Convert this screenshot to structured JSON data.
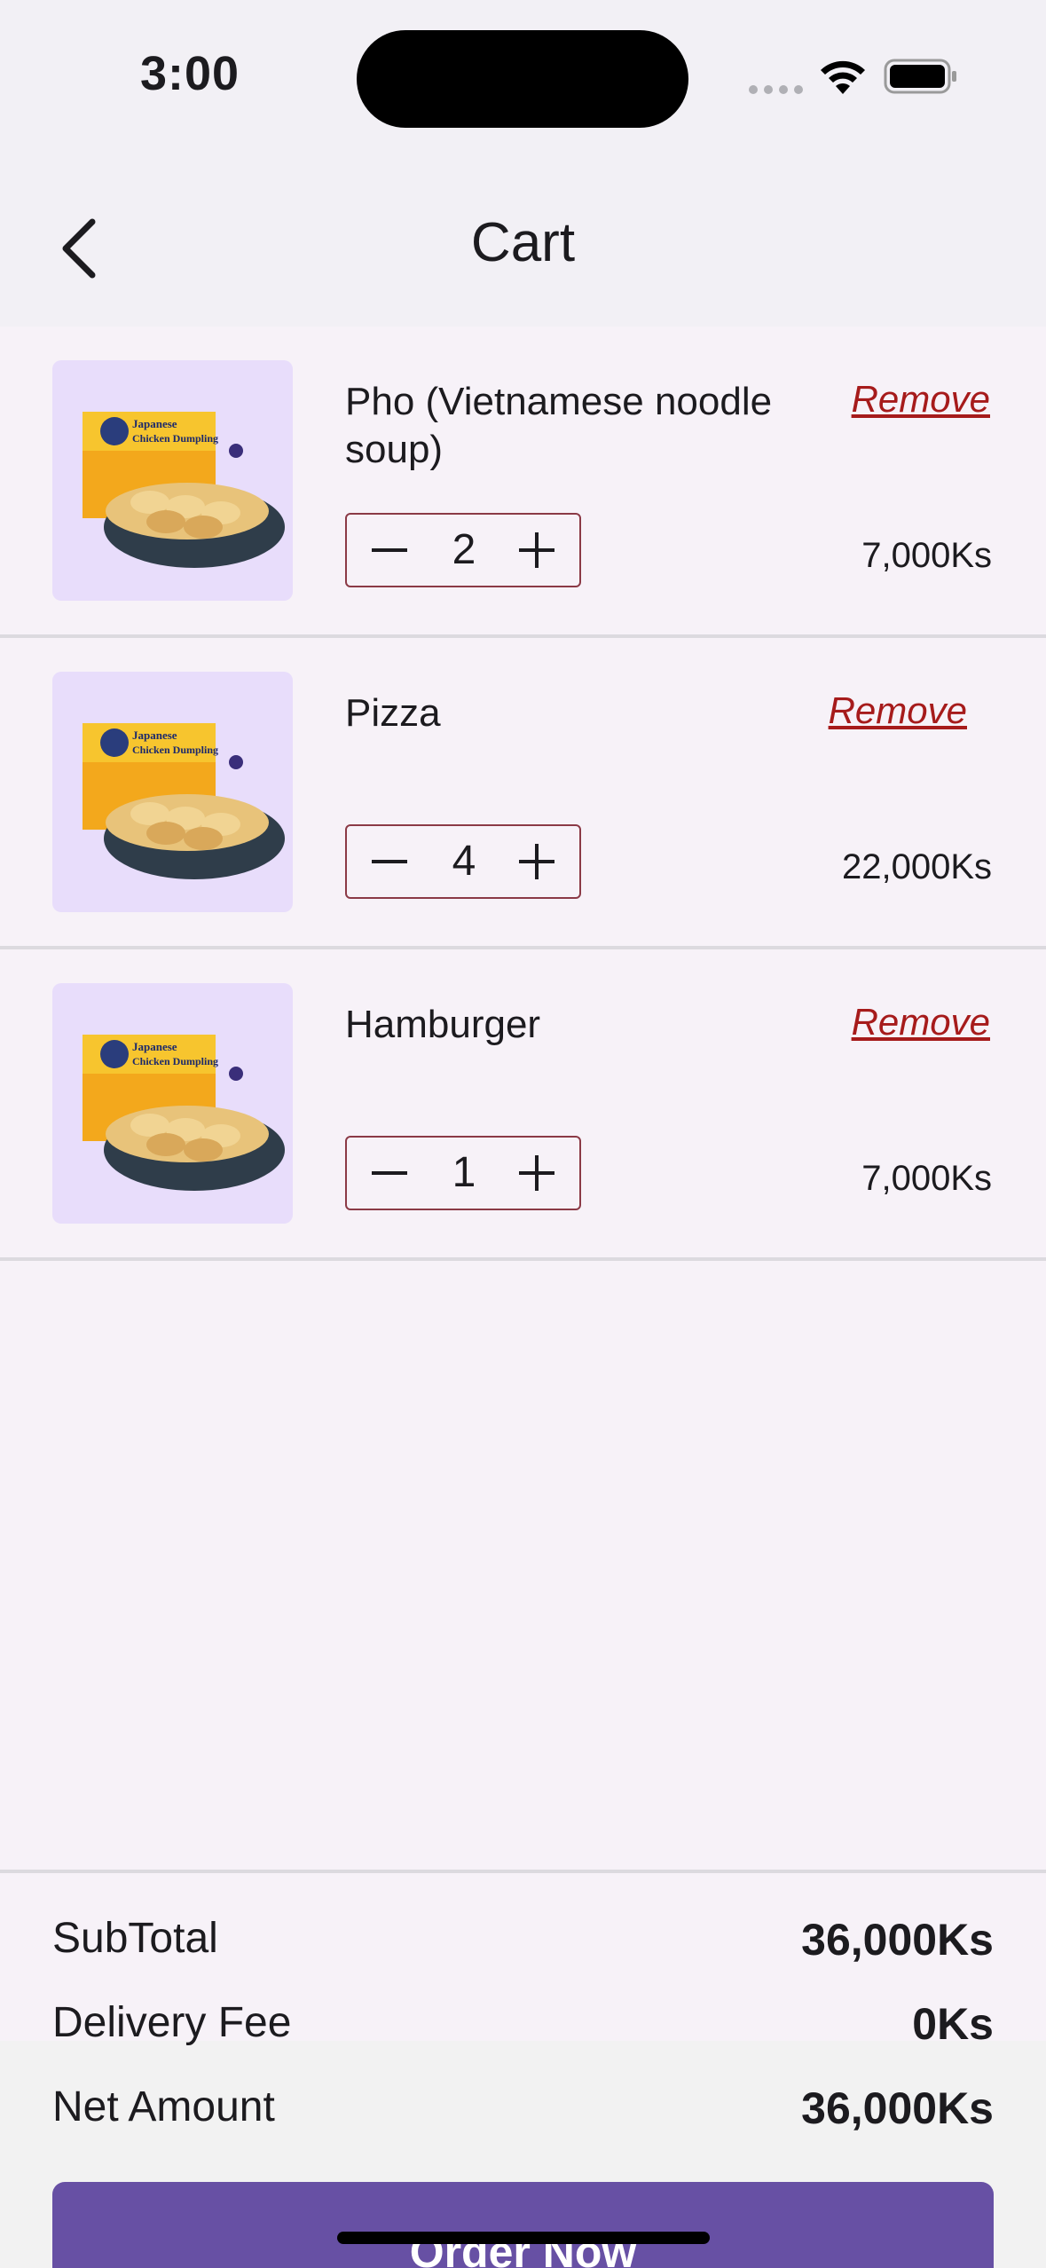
{
  "status_bar": {
    "time": "3:00",
    "icons": [
      "signal-icon",
      "wifi-icon",
      "battery-icon"
    ]
  },
  "app_bar": {
    "back_icon": "chevron-left-icon",
    "title": "Cart"
  },
  "cart": {
    "remove_label": "Remove",
    "thumbnail_label_lines": [
      "Japanese",
      "Chicken Dumpling"
    ],
    "items": [
      {
        "name": "Pho (Vietnamese noodle soup)",
        "quantity": "2",
        "price": "7,000Ks"
      },
      {
        "name": "Pizza",
        "quantity": "4",
        "price": "22,000Ks"
      },
      {
        "name": "Hamburger",
        "quantity": "1",
        "price": "7,000Ks"
      }
    ]
  },
  "summary": {
    "subtotal_label": "SubTotal",
    "subtotal_value": "36,000Ks",
    "delivery_label": "Delivery Fee",
    "delivery_value": "0Ks",
    "net_label": "Net Amount",
    "net_value": "36,000Ks"
  },
  "order_button_label": "Order Now",
  "colors": {
    "accent": "#6750a4",
    "remove": "#a61b1b",
    "stepper_border": "#8b3a46",
    "thumb_bg": "#e8ddfb"
  }
}
